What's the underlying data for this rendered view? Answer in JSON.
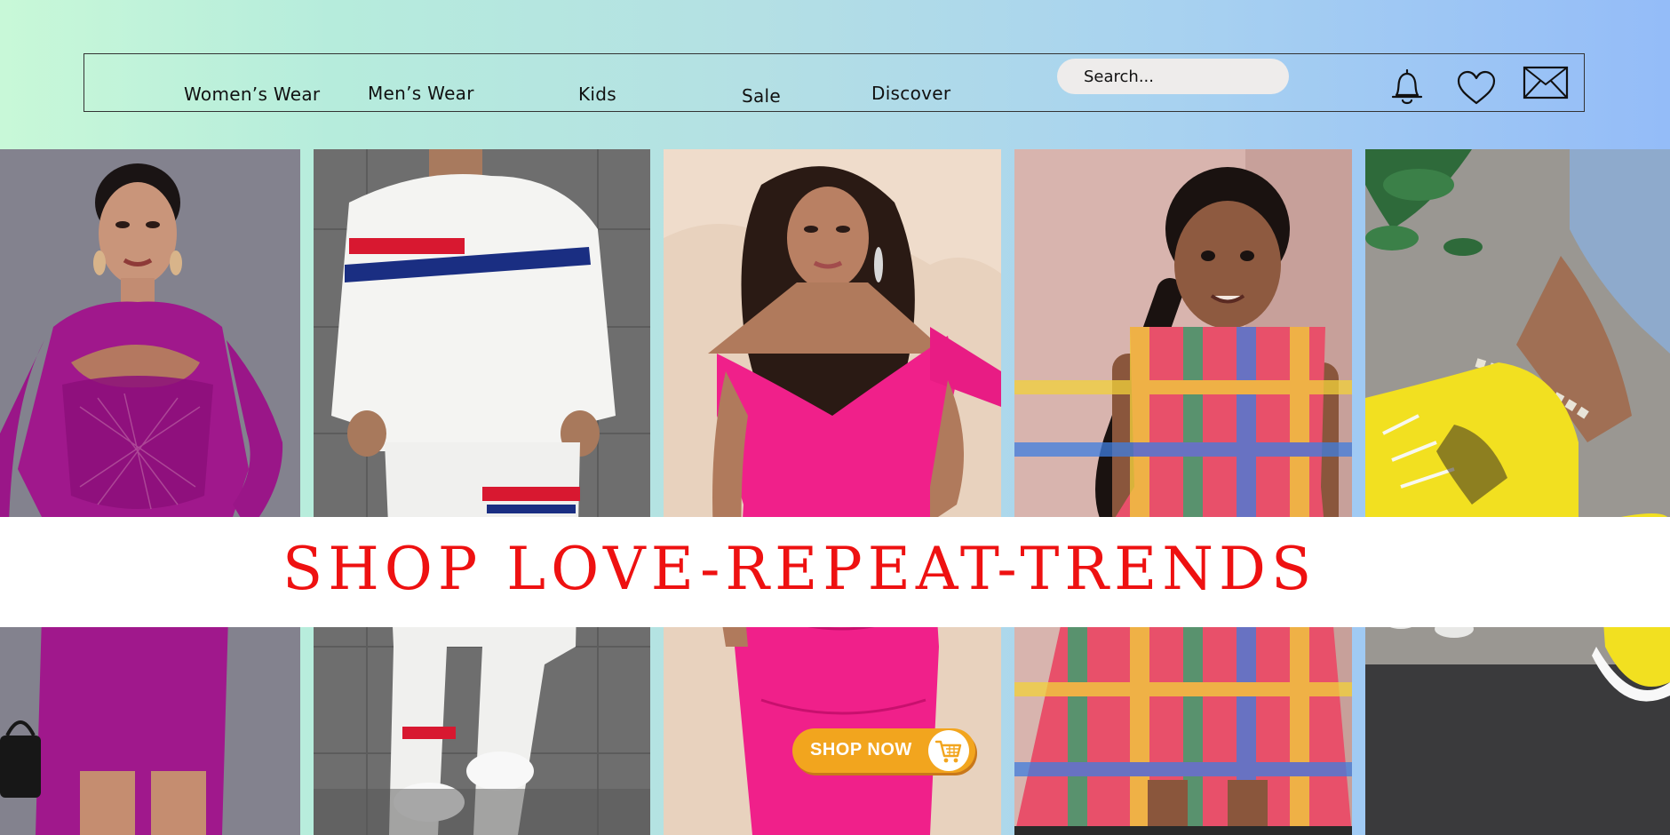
{
  "nav": {
    "items": [
      {
        "label": "Women’s Wear"
      },
      {
        "label": "Men’s Wear"
      },
      {
        "label": "Kids"
      },
      {
        "label": "Sale"
      },
      {
        "label": "Discover"
      }
    ],
    "search_placeholder": "Search..."
  },
  "header_icons": [
    "bell-icon",
    "heart-icon",
    "envelope-icon"
  ],
  "banner": {
    "title": "SHOP LOVE-REPEAT-TRENDS"
  },
  "cta": {
    "label": "SHOP NOW",
    "icon": "cart-icon"
  },
  "colors": {
    "banner_text": "#ee1111",
    "cta_bg": "#f2a51e",
    "gradient_start": "#c8f8d8",
    "gradient_end": "#94bcf8"
  },
  "panels": [
    {
      "category": "women-dress",
      "dress_color": "#a0188c"
    },
    {
      "category": "men-tracksuit",
      "outfit_color": "#ffffff"
    },
    {
      "category": "women-pink-dress",
      "dress_color": "#f0208a"
    },
    {
      "category": "kids-plaid-dress",
      "dress_color": "#e8506a"
    },
    {
      "category": "yellow-sneakers",
      "shoe_color": "#f2e020"
    }
  ]
}
